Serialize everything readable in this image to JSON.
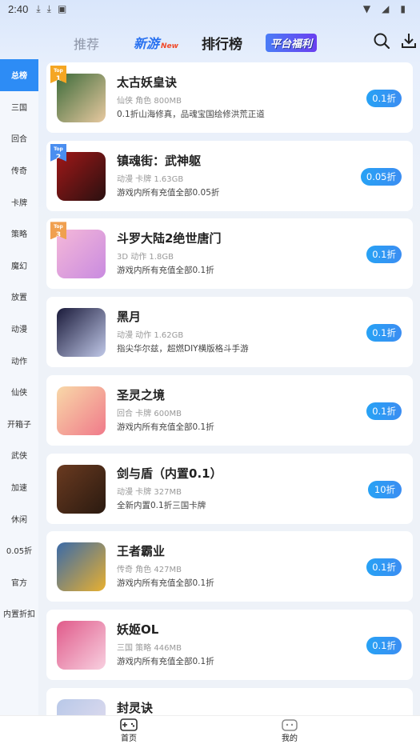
{
  "status_bar": {
    "time": "2:40"
  },
  "top_nav": {
    "tabs": [
      {
        "label": "推荐"
      },
      {
        "label": "新游",
        "tag": "New"
      },
      {
        "label": "排行榜"
      },
      {
        "label": "平台福利"
      }
    ]
  },
  "sidebar": {
    "items": [
      "总榜",
      "三国",
      "回合",
      "传奇",
      "卡牌",
      "策略",
      "魔幻",
      "放置",
      "动漫",
      "动作",
      "仙侠",
      "开箱子",
      "武侠",
      "加速",
      "休闲",
      "0.05折",
      "官方",
      "内置折扣"
    ]
  },
  "games": [
    {
      "name": "太古妖皇诀",
      "meta": "仙侠 角色 800MB",
      "desc": "0.1折山海修真，品魂宝国绘修洪荒正道",
      "discount": "0.1折",
      "rank": "1",
      "top_label": "Top",
      "colors": [
        "#3d6b3a",
        "#e8c9a0"
      ]
    },
    {
      "name": "镇魂街：武神躯",
      "meta": "动漫 卡牌 1.63GB",
      "desc": "游戏内所有充值全部0.05折",
      "discount": "0.05折",
      "rank": "2",
      "top_label": "Top",
      "colors": [
        "#a01818",
        "#2a1010"
      ]
    },
    {
      "name": "斗罗大陆2绝世唐门",
      "meta": "3D 动作 1.8GB",
      "desc": "游戏内所有充值全部0.1折",
      "discount": "0.1折",
      "rank": "3",
      "top_label": "Top",
      "colors": [
        "#f5b8d8",
        "#c98be0"
      ]
    },
    {
      "name": "黑月",
      "meta": "动漫 动作 1.62GB",
      "desc": "指尖华尔兹，超燃DIY横版格斗手游",
      "discount": "0.1折",
      "colors": [
        "#1a1a3a",
        "#c0c8e8"
      ]
    },
    {
      "name": "圣灵之境",
      "meta": "回合 卡牌 600MB",
      "desc": "游戏内所有充值全部0.1折",
      "discount": "0.1折",
      "colors": [
        "#f8d8a8",
        "#f07a8a"
      ]
    },
    {
      "name": "剑与盾（内置0.1）",
      "meta": "动漫 卡牌 327MB",
      "desc": "全新内置0.1折三国卡牌",
      "discount": "10折",
      "colors": [
        "#6a3a20",
        "#2a1a10"
      ]
    },
    {
      "name": "王者霸业",
      "meta": "传奇 角色 427MB",
      "desc": "游戏内所有充值全部0.1折",
      "discount": "0.1折",
      "colors": [
        "#3a6aa8",
        "#e8b030"
      ]
    },
    {
      "name": "妖姬OL",
      "meta": "三国 策略 446MB",
      "desc": "游戏内所有充值全部0.1折",
      "discount": "0.1折",
      "colors": [
        "#e05a8a",
        "#f8d0e0"
      ]
    },
    {
      "name": "封灵诀",
      "meta": "",
      "desc": "",
      "discount": "",
      "colors": [
        "#b8c8e8",
        "#e8e0f0"
      ]
    }
  ],
  "bottom_bar": {
    "home": "首页",
    "mine": "我的"
  }
}
